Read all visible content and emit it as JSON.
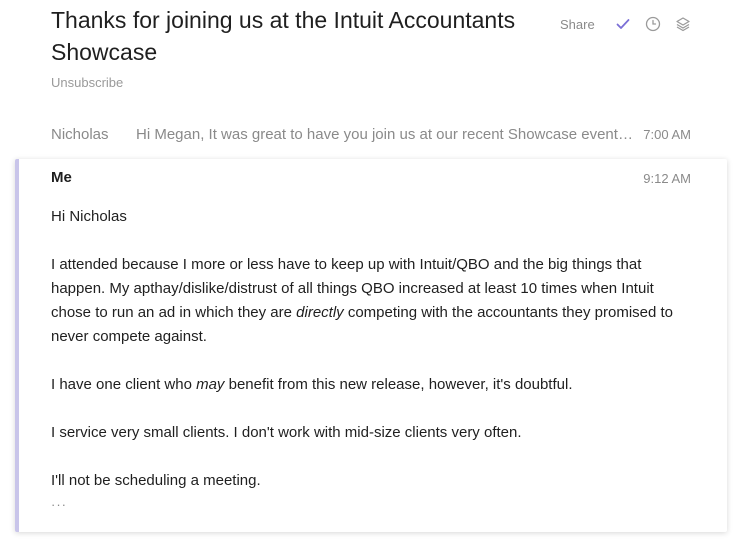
{
  "header": {
    "subject": "Thanks for joining us at the Intuit Accountants Showcase",
    "unsubscribe_label": "Unsubscribe",
    "share_label": "Share",
    "icons": [
      "checkmark-icon",
      "clock-icon",
      "layers-icon"
    ],
    "accent_color": "#7b6fd6"
  },
  "thread": {
    "collapsed": {
      "sender": "Nicholas",
      "snippet": "Hi Megan, It was great to have you join us at our recent Showcase event. Do you have time to meet next week?",
      "time": "7:00 AM"
    },
    "expanded": {
      "sender": "Me",
      "time": "9:12 AM",
      "greeting": "Hi Nicholas",
      "p1_before": "I attended because I more or less have to keep up with Intuit/QBO and the big things that happen. My apthay/dislike/distrust of all things QBO increased at least 10 times when Intuit chose to run an ad in which they are ",
      "p1_em": "directly",
      "p1_after": " competing with the accountants they promised to never compete against.",
      "p2_before": "I have one client who ",
      "p2_em": "may",
      "p2_after": " benefit from this new release, however, it's doubtful.",
      "p3": "I service very small clients. I don't work with mid-size clients very often.",
      "p4": "I'll not be scheduling a meeting.",
      "more_label": "···",
      "accent_bar_color": "#c9c5ea"
    }
  }
}
